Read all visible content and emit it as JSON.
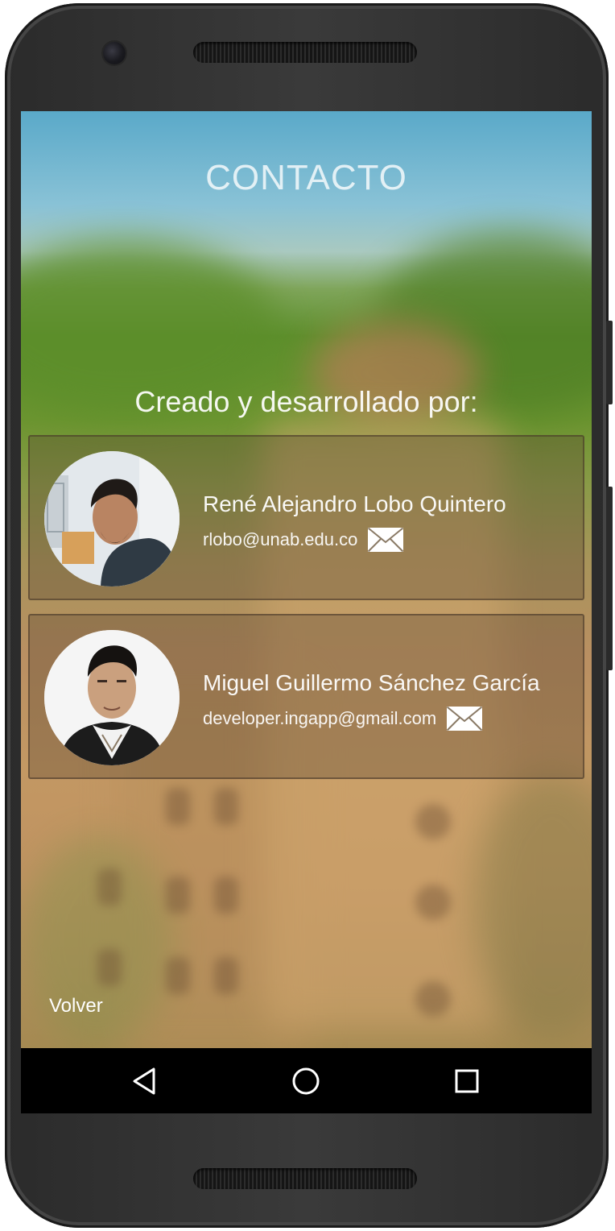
{
  "screen": {
    "title": "CONTACTO",
    "credits_heading": "Creado y desarrollado por:",
    "back_label": "Volver"
  },
  "developers": [
    {
      "name": "René Alejandro Lobo Quintero",
      "email": "rlobo@unab.edu.co"
    },
    {
      "name": "Miguel Guillermo Sánchez García",
      "email": "developer.ingapp@gmail.com"
    }
  ],
  "icons": {
    "email": "envelope-icon",
    "nav_back": "triangle-back-icon",
    "nav_home": "circle-home-icon",
    "nav_recent": "square-recent-icon"
  },
  "colors": {
    "card_background": "#5a4632",
    "navbar": "#000000",
    "text": "#ffffff"
  }
}
